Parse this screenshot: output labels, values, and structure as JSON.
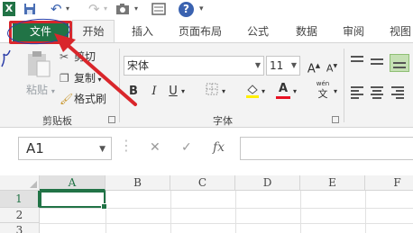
{
  "qat": {
    "app_letter": "X",
    "undo": "↶",
    "redo": "↷",
    "customize": "▾",
    "help": "?"
  },
  "tabs": [
    "文件",
    "开始",
    "插入",
    "页面布局",
    "公式",
    "数据",
    "审阅",
    "视图"
  ],
  "clipboard": {
    "paste": "粘贴",
    "cut": "剪切",
    "copy": "复制",
    "format_painter": "格式刷",
    "group_label": "剪贴板"
  },
  "font": {
    "name": "宋体",
    "size": "11",
    "grow": "A",
    "shrink": "A",
    "bold": "B",
    "italic": "I",
    "underline": "U",
    "font_color_letter": "A",
    "phonetic": "wén",
    "phonetic_char": "文",
    "group_label": "字体"
  },
  "formula_bar": {
    "name_box": "A1",
    "fx": "fx",
    "cancel": "✕",
    "enter": "✓"
  },
  "grid": {
    "columns": [
      "A",
      "B",
      "C",
      "D",
      "E",
      "F"
    ],
    "rows": [
      "1",
      "2",
      "3"
    ]
  },
  "colors": {
    "excel_green": "#217346",
    "annotation_red": "#d9262b",
    "annotation_blue": "#2c3ea8"
  }
}
